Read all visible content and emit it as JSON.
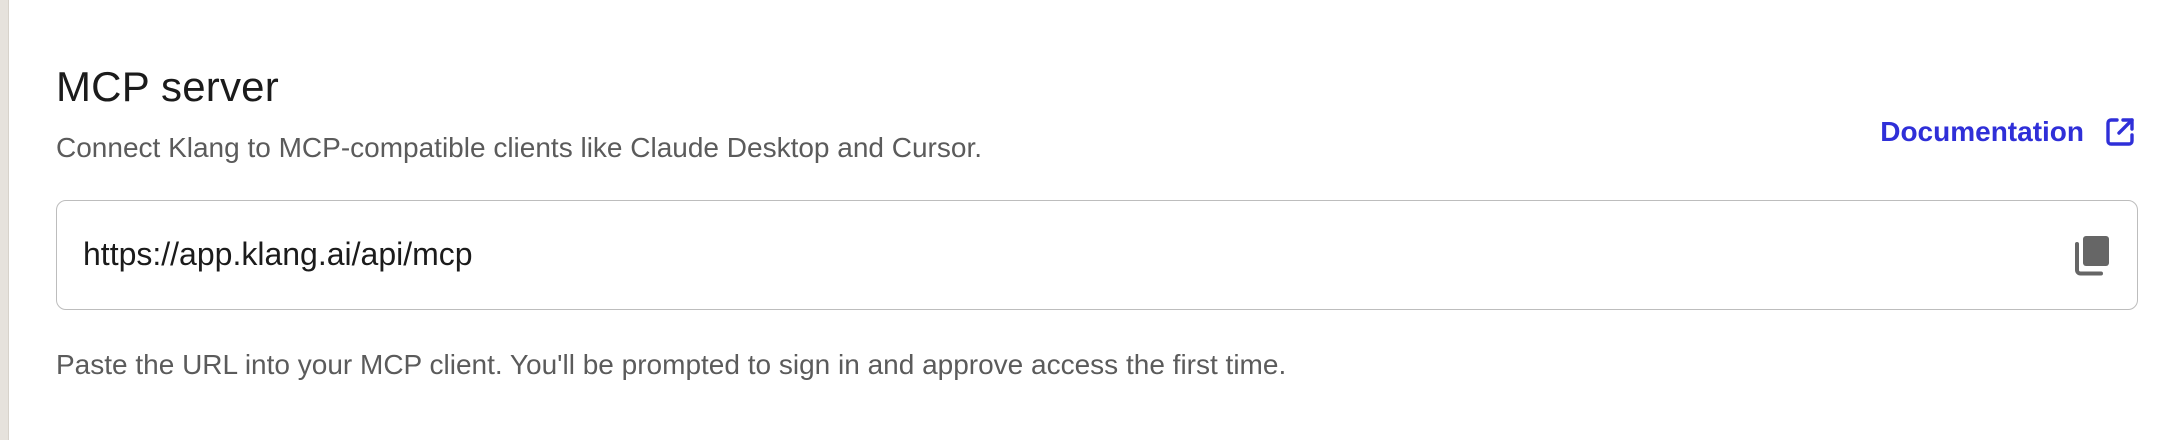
{
  "mcp_server": {
    "title": "MCP server",
    "description": "Connect Klang to MCP-compatible clients like Claude Desktop and Cursor.",
    "documentation_link": {
      "label": "Documentation",
      "icon": "external-link-icon",
      "color": "#2f2fd8"
    },
    "url_field": {
      "value": "https://app.klang.ai/api/mcp",
      "copy_icon": "copy-icon"
    },
    "helper_text": "Paste the URL into your MCP client. You'll be prompted to sign in and approve access the first time."
  },
  "colors": {
    "text_primary": "#1b1b1b",
    "text_secondary": "#5b5b5b",
    "accent": "#2f2fd8",
    "border": "#bdbdbd",
    "icon": "#666666"
  }
}
